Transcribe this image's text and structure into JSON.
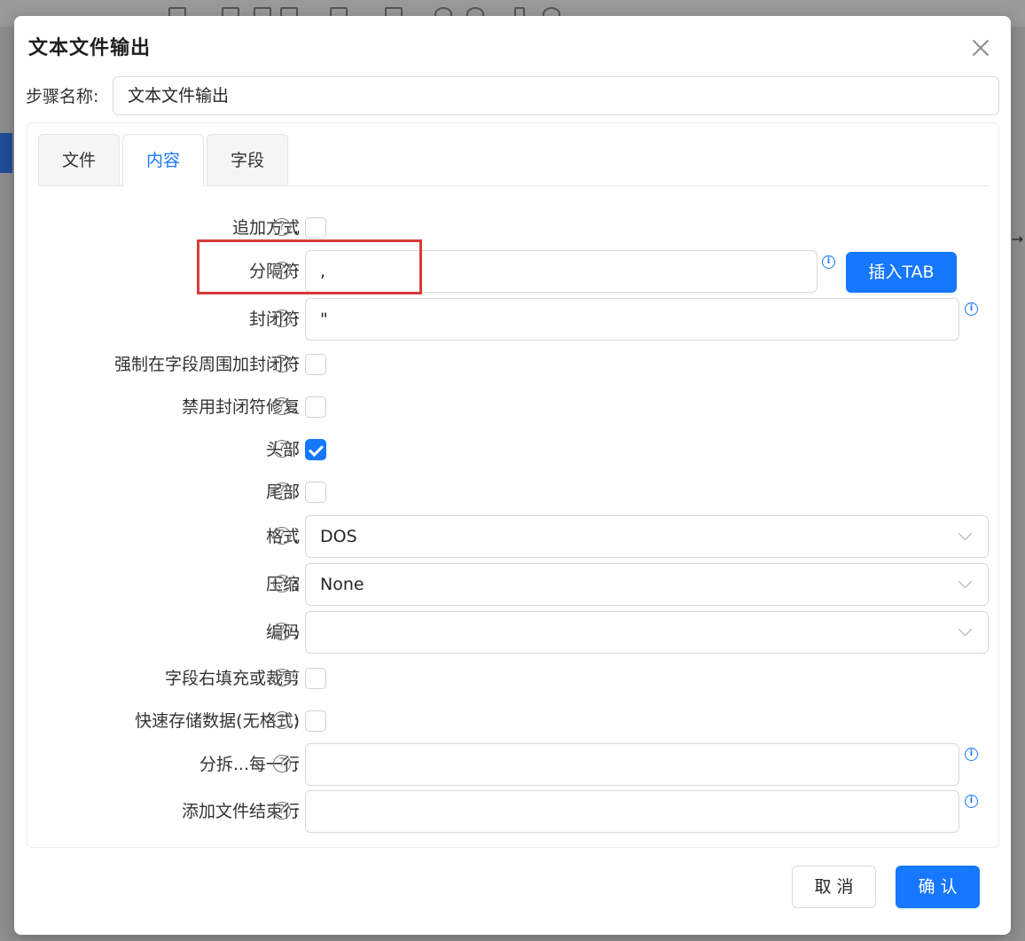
{
  "dialog": {
    "title": "文本文件输出",
    "step_name_label": "步骤名称:",
    "step_name_value": "文本文件输出"
  },
  "tabs": [
    {
      "label": "文件",
      "active": false
    },
    {
      "label": "内容",
      "active": true
    },
    {
      "label": "字段",
      "active": false
    }
  ],
  "form": {
    "help_glyph": "?",
    "colon": ":",
    "info_glyph": "i",
    "append": {
      "label": "追加方式",
      "checked": false
    },
    "separator": {
      "label": "分隔符",
      "value": ",",
      "insert_tab_button": "插入TAB"
    },
    "enclosure": {
      "label": "封闭符",
      "value": "\""
    },
    "force_enclosure": {
      "label": "强制在字段周围加封闭符",
      "checked": false
    },
    "disable_enclosure_fix": {
      "label": "禁用封闭符修复",
      "checked": false
    },
    "header": {
      "label": "头部",
      "checked": true
    },
    "footer": {
      "label": "尾部",
      "checked": false
    },
    "format": {
      "label": "格式",
      "value": "DOS"
    },
    "compression": {
      "label": "压缩",
      "value": "None"
    },
    "encoding": {
      "label": "编码",
      "value": ""
    },
    "right_pad": {
      "label": "字段右填充或裁剪",
      "checked": false
    },
    "fast_dump": {
      "label": "快速存储数据(无格式)",
      "checked": false
    },
    "split_every": {
      "label": "分拆...每一行",
      "value": ""
    },
    "end_line": {
      "label": "添加文件结束行",
      "value": ""
    }
  },
  "footer_buttons": {
    "cancel": "取 消",
    "confirm": "确 认"
  },
  "colors": {
    "primary": "#1677ff",
    "highlight": "#d83a3a",
    "overlay": "#8f8f8f"
  }
}
